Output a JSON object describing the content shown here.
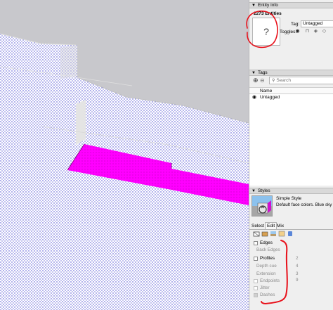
{
  "entity_info": {
    "header": "Entity Info",
    "count": "2273 Entities",
    "thumbnail_glyph": "?",
    "tag_label": "Tag:",
    "tag_value": "Untagged",
    "toggles_label": "Toggles:",
    "toggle_icons": [
      "eye-icon",
      "lock-icon",
      "cast-shadow-icon",
      "receive-shadow-icon"
    ]
  },
  "tags": {
    "header": "Tags",
    "search_placeholder": "Search",
    "column_name": "Name",
    "rows": [
      {
        "name": "Untagged",
        "visible": true
      }
    ]
  },
  "styles": {
    "header": "Styles",
    "style_name": "Simple Style",
    "style_description": "Default face colors. Blue sky and gray ground.",
    "tabs": [
      "Select",
      "Edit",
      "Mix"
    ],
    "active_tab": "Edit",
    "options": [
      {
        "label": "Edges",
        "enabled": true,
        "checked": false
      },
      {
        "label": "Back Edges",
        "enabled": false,
        "checked": false
      },
      {
        "label": "Profiles",
        "enabled": true,
        "checked": false,
        "value": "2"
      },
      {
        "label": "Depth cue",
        "enabled": false,
        "checked": false,
        "value": "4"
      },
      {
        "label": "Extension",
        "enabled": false,
        "checked": false,
        "value": "3"
      },
      {
        "label": "Endpoints",
        "enabled": false,
        "checked": false,
        "value": "9"
      },
      {
        "label": "Jitter",
        "enabled": false,
        "checked": false
      },
      {
        "label": "Dashes",
        "enabled": false,
        "checked": true
      }
    ]
  },
  "colors": {
    "selected_face": "#ff00ff",
    "selection_dots": "#4040d0",
    "annotation": "#e8101a",
    "background": "#c8c8cc"
  }
}
